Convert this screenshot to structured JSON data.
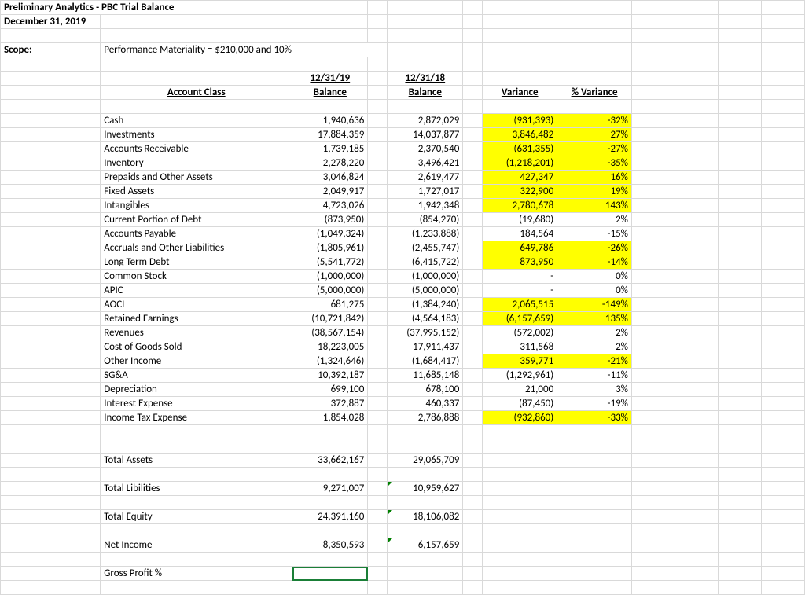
{
  "header": {
    "title": "Preliminary Analytics - PBC Trial Balance",
    "date": "December 31, 2019",
    "scope_label": "Scope:",
    "scope_value": "Performance Materiality = $210,000 and 10%"
  },
  "columns": {
    "account_class": "Account Class",
    "date1": "12/31/19",
    "bal1": "Balance",
    "date2": "12/31/18",
    "bal2": "Balance",
    "variance": "Variance",
    "pct_variance": "% Variance"
  },
  "rows": [
    {
      "label": "Cash",
      "b1": "1,940,636",
      "b2": "2,872,029",
      "var": "(931,393)",
      "pct": "-32%",
      "hl": true
    },
    {
      "label": "Investments",
      "b1": "17,884,359",
      "b2": "14,037,877",
      "var": "3,846,482",
      "pct": "27%",
      "hl": true
    },
    {
      "label": "Accounts Receivable",
      "b1": "1,739,185",
      "b2": "2,370,540",
      "var": "(631,355)",
      "pct": "-27%",
      "hl": true
    },
    {
      "label": "Inventory",
      "b1": "2,278,220",
      "b2": "3,496,421",
      "var": "(1,218,201)",
      "pct": "-35%",
      "hl": true
    },
    {
      "label": "Prepaids and Other Assets",
      "b1": "3,046,824",
      "b2": "2,619,477",
      "var": "427,347",
      "pct": "16%",
      "hl": true
    },
    {
      "label": "Fixed Assets",
      "b1": "2,049,917",
      "b2": "1,727,017",
      "var": "322,900",
      "pct": "19%",
      "hl": true
    },
    {
      "label": "Intangibles",
      "b1": "4,723,026",
      "b2": "1,942,348",
      "var": "2,780,678",
      "pct": "143%",
      "hl": true
    },
    {
      "label": "Current Portion of Debt",
      "b1": "(873,950)",
      "b2": "(854,270)",
      "var": "(19,680)",
      "pct": "2%",
      "hl": false
    },
    {
      "label": "Accounts Payable",
      "b1": "(1,049,324)",
      "b2": "(1,233,888)",
      "var": "184,564",
      "pct": "-15%",
      "hl": false
    },
    {
      "label": "Accruals and Other Liabilities",
      "b1": "(1,805,961)",
      "b2": "(2,455,747)",
      "var": "649,786",
      "pct": "-26%",
      "hl": true
    },
    {
      "label": "Long Term Debt",
      "b1": "(5,541,772)",
      "b2": "(6,415,722)",
      "var": "873,950",
      "pct": "-14%",
      "hl": true
    },
    {
      "label": "Common Stock",
      "b1": "(1,000,000)",
      "b2": "(1,000,000)",
      "var": "-",
      "pct": "0%",
      "hl": false
    },
    {
      "label": "APIC",
      "b1": "(5,000,000)",
      "b2": "(5,000,000)",
      "var": "-",
      "pct": "0%",
      "hl": false
    },
    {
      "label": "AOCI",
      "b1": "681,275",
      "b2": "(1,384,240)",
      "var": "2,065,515",
      "pct": "-149%",
      "hl": true
    },
    {
      "label": "Retained Earnings",
      "b1": "(10,721,842)",
      "b2": "(4,564,183)",
      "var": "(6,157,659)",
      "pct": "135%",
      "hl": true
    },
    {
      "label": "Revenues",
      "b1": "(38,567,154)",
      "b2": "(37,995,152)",
      "var": "(572,002)",
      "pct": "2%",
      "hl": false
    },
    {
      "label": "Cost of Goods Sold",
      "b1": "18,223,005",
      "b2": "17,911,437",
      "var": "311,568",
      "pct": "2%",
      "hl": false
    },
    {
      "label": "Other Income",
      "b1": "(1,324,646)",
      "b2": "(1,684,417)",
      "var": "359,771",
      "pct": "-21%",
      "hl": true
    },
    {
      "label": "SG&A",
      "b1": "10,392,187",
      "b2": "11,685,148",
      "var": "(1,292,961)",
      "pct": "-11%",
      "hl": false
    },
    {
      "label": "Depreciation",
      "b1": "699,100",
      "b2": "678,100",
      "var": "21,000",
      "pct": "3%",
      "hl": false
    },
    {
      "label": "Interest Expense",
      "b1": "372,887",
      "b2": "460,337",
      "var": "(87,450)",
      "pct": "-19%",
      "hl": false
    },
    {
      "label": "Income Tax Expense",
      "b1": "1,854,028",
      "b2": "2,786,888",
      "var": "(932,860)",
      "pct": "-33%",
      "hl": true
    }
  ],
  "totals": {
    "assets": {
      "label": "Total Assets",
      "b1": "33,662,167",
      "b2": "29,065,709"
    },
    "liab": {
      "label": "Total Libilities",
      "b1": "9,271,007",
      "b2": "10,959,627",
      "flag": true
    },
    "equity": {
      "label": "Total Equity",
      "b1": "24,391,160",
      "b2": "18,106,082",
      "flag": true
    },
    "ni": {
      "label": "Net Income",
      "b1": "8,350,593",
      "b2": "6,157,659",
      "flag": true
    },
    "gp": {
      "label": "Gross Profit %"
    }
  }
}
